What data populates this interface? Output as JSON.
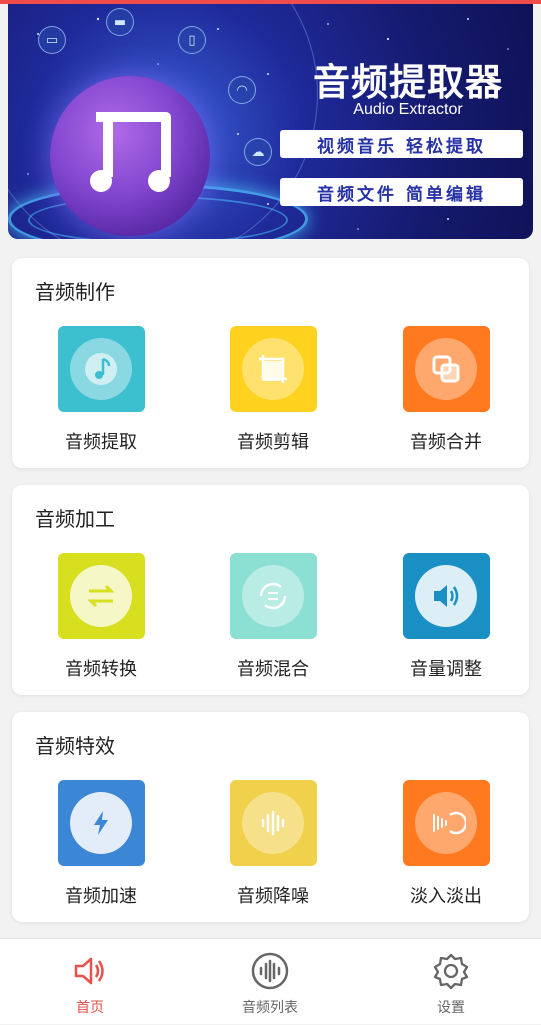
{
  "banner": {
    "title": "音频提取器",
    "subtitle": "Audio Extractor",
    "tagline1": "视频音乐 轻松提取",
    "tagline2": "音频文件 简单编辑"
  },
  "sections": [
    {
      "title": "音频制作",
      "items": [
        {
          "label": "音频提取",
          "icon": "music-note-icon",
          "color": "#3cbfce"
        },
        {
          "label": "音频剪辑",
          "icon": "crop-icon",
          "color": "#ffd21f"
        },
        {
          "label": "音频合并",
          "icon": "merge-icon",
          "color": "#ff7a1f"
        }
      ]
    },
    {
      "title": "音频加工",
      "items": [
        {
          "label": "音频转换",
          "icon": "swap-arrows-icon",
          "color": "#d7df1e"
        },
        {
          "label": "音频混合",
          "icon": "cycle-arrows-icon",
          "color": "#8be0d3"
        },
        {
          "label": "音量调整",
          "icon": "speaker-icon",
          "color": "#1a8fc4"
        }
      ]
    },
    {
      "title": "音频特效",
      "items": [
        {
          "label": "音频加速",
          "icon": "lightning-icon",
          "color": "#3c86d6"
        },
        {
          "label": "音频降噪",
          "icon": "waveform-icon",
          "color": "#f1d04c"
        },
        {
          "label": "淡入淡出",
          "icon": "fade-wave-icon",
          "color": "#ff7a1f"
        }
      ]
    }
  ],
  "nav": {
    "home": "首页",
    "list": "音频列表",
    "settings": "设置",
    "active_color": "#e8504a"
  }
}
